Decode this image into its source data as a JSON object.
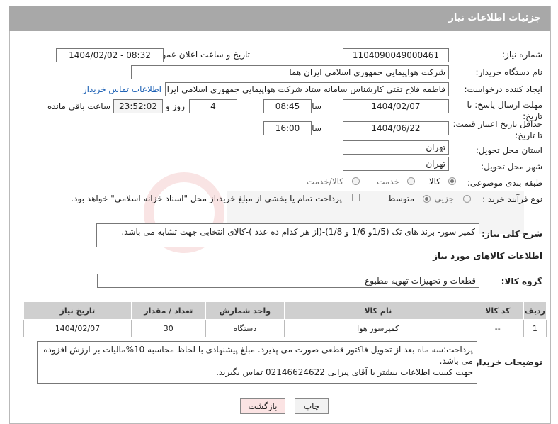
{
  "header": {
    "title": "جزئیات اطلاعات نیاز"
  },
  "form": {
    "need_number": {
      "label": "شماره نیاز:",
      "value": "1104090049000461"
    },
    "announce": {
      "label": "تاریخ و ساعت اعلان عمومی:",
      "value": "1404/02/02 - 08:32"
    },
    "buyer_org": {
      "label": "نام دستگاه خریدار:",
      "value": "شرکت هواپیمایی جمهوری اسلامی ایران هما"
    },
    "requester": {
      "label": "ایجاد کننده درخواست:",
      "value": "فاطمه فلاح تفتی کارشناس سامانه ستاد شرکت هواپیمایی جمهوری اسلامی ایران هما",
      "contact_link": "اطلاعات تماس خریدار"
    },
    "deadline": {
      "label": "مهلت ارسال پاسخ: تا تاریخ:",
      "date": "1404/02/07",
      "time_label": "ساعت",
      "time": "08:45",
      "days": "4",
      "days_label": "روز و",
      "remaining": "23:52:02",
      "remaining_label": "ساعت باقی مانده"
    },
    "price_validity": {
      "label": "حداقل تاریخ اعتبار قیمت: تا تاریخ:",
      "date": "1404/06/22",
      "time_label": "ساعت",
      "time": "16:00"
    },
    "province": {
      "label": "استان محل تحویل:",
      "value": "تهران"
    },
    "city": {
      "label": "شهر محل تحویل:",
      "value": "تهران"
    },
    "category": {
      "label": "طبقه بندی موضوعی:",
      "options": [
        "کالا",
        "خدمت",
        "کالا/خدمت"
      ]
    },
    "process": {
      "label": "نوع فرآیند خرید :",
      "options": [
        "جزیی",
        "متوسط"
      ],
      "note": "پرداخت تمام یا بخشی از مبلغ خرید،از محل \"اسناد خزانه اسلامی\" خواهد بود."
    }
  },
  "summary": {
    "label": "شرح کلی نیاز:",
    "value": "کمپر سور- برند های تک (1/5و 1/6 و 1/8)-(از هر کدام ده عدد )-کالای انتخابی جهت تشابه می باشد."
  },
  "goods_section": {
    "title": "اطلاعات کالاهای مورد نیاز"
  },
  "goods_group": {
    "label": "گروه کالا:",
    "value": "قطعات و تجهیزات تهویه مطبوع"
  },
  "table": {
    "headers": [
      "ردیف",
      "کد کالا",
      "نام کالا",
      "واحد شمارش",
      "تعداد / مقدار",
      "تاریخ نیاز"
    ],
    "rows": [
      [
        "1",
        "--",
        "کمپرسور هوا",
        "دستگاه",
        "30",
        "1404/02/07"
      ]
    ]
  },
  "buyer_notes": {
    "label": "توضیحات خریدار:",
    "line1": "پرداخت:سه ماه بعد از تحویل فاکتور قطعی صورت می پذیرد. مبلغ پیشنهادی با لحاظ محاسبه 10%مالیات بر ارزش افزوده می باشد.",
    "line2": "جهت کسب اطلاعات بیشتر با آقای پیرانی 02146624622 تماس بگیرید."
  },
  "buttons": {
    "print": "چاپ",
    "back": "بازگشت"
  },
  "colors": {
    "header_bg": "#a8a8a8",
    "link": "#1a5fb4",
    "back_btn_bg": "#fbe3e3"
  }
}
